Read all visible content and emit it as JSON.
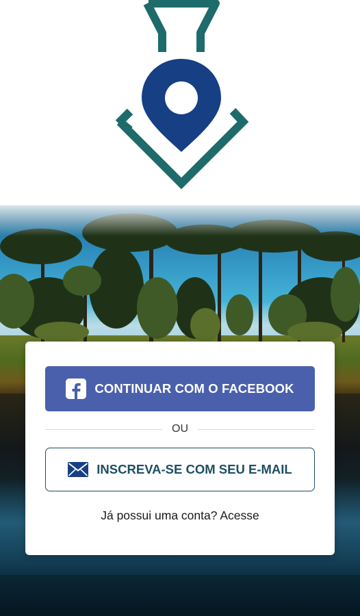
{
  "colors": {
    "logo_teal": "#1e6b6b",
    "logo_blue": "#163f84",
    "facebook_blue": "#4a60ac",
    "email_accent": "#1d4e63"
  },
  "logo": {
    "icon": "location-pin-hanger-logo"
  },
  "auth_card": {
    "facebook_button": {
      "icon": "facebook-icon",
      "label": "CONTINUAR COM O FACEBOOK"
    },
    "divider_text": "OU",
    "email_button": {
      "icon": "envelope-icon",
      "label": "INSCREVA-SE COM SEU E-MAIL"
    },
    "login_prompt": "Já possui uma conta? Acesse"
  }
}
